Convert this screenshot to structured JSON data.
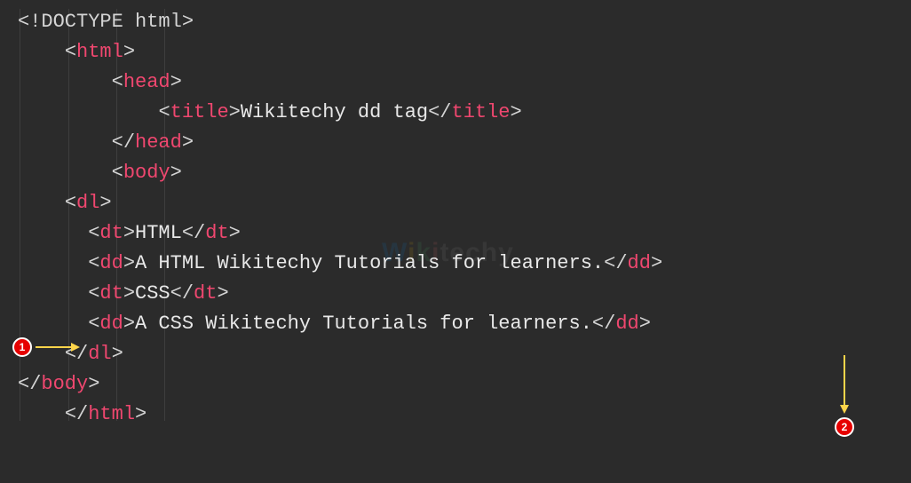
{
  "editor": {
    "watermark": "Wikitechy"
  },
  "code": {
    "l1_doctype": "<!DOCTYPE html>",
    "l2_open": "html",
    "l3_open": "head",
    "l4_open": "title",
    "l4_text": "Wikitechy dd tag",
    "l4_close": "title",
    "l5_close": "head",
    "l6_open": "body",
    "l7_open": "dl",
    "l8_open": "dt",
    "l8_text": "HTML",
    "l8_close": "dt",
    "l9_open": "dd",
    "l9_text": "A HTML Wikitechy Tutorials for learners.",
    "l9_close": "dd",
    "l10_open": "dt",
    "l10_text": "CSS",
    "l10_close": "dt",
    "l11_open": "dd",
    "l11_text": "A CSS Wikitechy Tutorials for learners.",
    "l11_close": "dd",
    "l12_close": "dl",
    "l13_close": "body",
    "l14_close": "html"
  },
  "annotations": {
    "badge1": "1",
    "badge2": "2"
  }
}
